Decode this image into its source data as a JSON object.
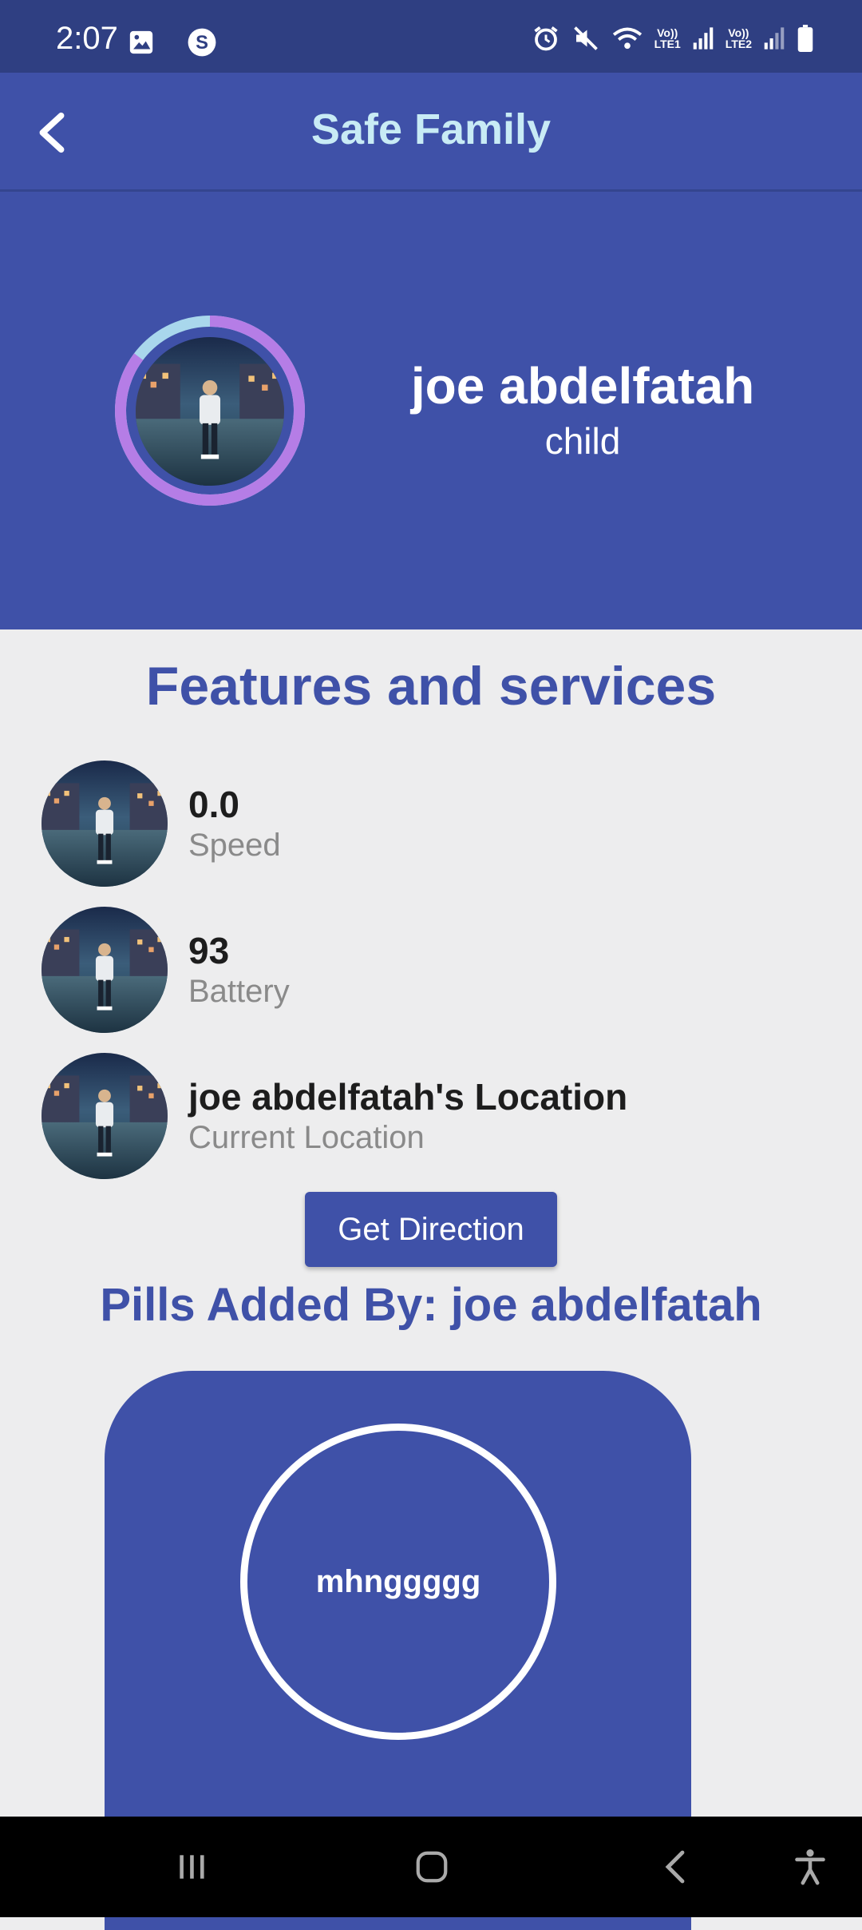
{
  "status_bar": {
    "time": "2:07",
    "left_icons": [
      "image-icon",
      "shazam-icon"
    ],
    "right_icons": [
      "alarm-icon",
      "mute-icon",
      "wifi-icon",
      "signal-lte1-icon",
      "signal-lte2-icon",
      "battery-icon"
    ],
    "lte1_label": "LTE1",
    "lte2_label": "LTE2",
    "volte_label": "Vo))"
  },
  "app_bar": {
    "title": "Safe Family",
    "back_icon": "chevron-left-icon"
  },
  "profile": {
    "name": "joe abdelfatah",
    "role": "child"
  },
  "features": {
    "title": "Features and services",
    "items": [
      {
        "value": "0.0",
        "label": "Speed"
      },
      {
        "value": "93",
        "label": "Battery"
      },
      {
        "value": "joe abdelfatah's Location",
        "label": "Current Location"
      }
    ],
    "direction_button": "Get Direction"
  },
  "pills": {
    "title": "Pills Added By: joe abdelfatah",
    "items": [
      {
        "name": "mhnggggg"
      }
    ]
  },
  "colors": {
    "primary": "#3f51a8",
    "status_bar": "#2f3f82",
    "title_text": "#c8ebf5",
    "background": "#ededee",
    "ring_purple": "#b57de6",
    "ring_light": "#a9d7ec"
  },
  "nav_bar": {
    "icons": [
      "recents-icon",
      "home-icon",
      "back-icon",
      "accessibility-icon"
    ]
  }
}
